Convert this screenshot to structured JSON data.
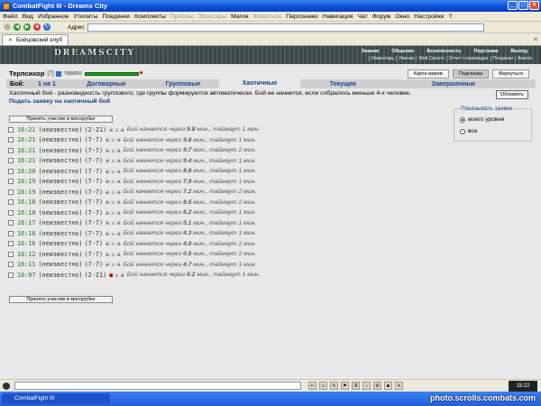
{
  "window": {
    "title": "CombatFight III - Dreams City"
  },
  "menu": [
    {
      "label": "Файл",
      "dim": false
    },
    {
      "label": "Вид",
      "dim": false
    },
    {
      "label": "Избранное",
      "dim": false
    },
    {
      "label": "Утилиты",
      "dim": false
    },
    {
      "label": "Поединки",
      "dim": false
    },
    {
      "label": "Комплекты",
      "dim": false
    },
    {
      "label": "Приёмы",
      "dim": true
    },
    {
      "label": "Эликсиры",
      "dim": true
    },
    {
      "label": "Магия",
      "dim": false
    },
    {
      "label": "Животное",
      "dim": true
    },
    {
      "label": "Персонажи",
      "dim": false
    },
    {
      "label": "Навигация",
      "dim": false
    },
    {
      "label": "Чат",
      "dim": false
    },
    {
      "label": "Форум",
      "dim": false
    },
    {
      "label": "Окно",
      "dim": false
    },
    {
      "label": "Настройки",
      "dim": false
    },
    {
      "label": "?",
      "dim": false
    }
  ],
  "toolbar": {
    "address_label": "Адрес"
  },
  "tab": {
    "label": "Бойцовский клуб"
  },
  "header": {
    "logo": "DREAMSCITY",
    "nav": [
      "Знания",
      "Общение",
      "Безопасность",
      "Персонаж",
      "Выход"
    ],
    "sub": [
      "Инвентарь",
      "Умения",
      "Мой Скролл",
      "Отчет о переводах",
      "Поединки",
      "Анкета"
    ]
  },
  "player": {
    "name": "Терпсихор",
    "level": "[7]",
    "hp": "788/800"
  },
  "top_buttons": [
    "Карта миров",
    "Подсказка",
    "Вернуться"
  ],
  "battle_tabs": {
    "label": "Бой:",
    "items": [
      "1 на 1",
      "Договорные",
      "Групповые",
      "Хаотичные",
      "Текущие",
      "Завершенные"
    ],
    "active_index": 3
  },
  "description": "Хаотичный бой - разновидность группового, где группы формируются автоматически. Бой не начнется, если собралось меньше 4-х человек.",
  "submit_link": "Подать заявку на хаотичный бой",
  "refresh_button": "Обновить",
  "filter": {
    "title": "Показывать заявки",
    "options": [
      "моего уровня",
      "все"
    ],
    "selected": 0
  },
  "join_button": "Принять участие в мясорубке",
  "bids": [
    {
      "time": "16:21",
      "who": "(неизвестно)",
      "range": "(2-21)",
      "drop": false,
      "pre": "Бой начнется через",
      "mins": "9.8",
      "mid": "мин., таймаут",
      "timeout": "1",
      "post": "мин."
    },
    {
      "time": "16:21",
      "who": "(неизвестно)",
      "range": "(7-7)",
      "drop": false,
      "pre": "Бой начнется через",
      "mins": "9.8",
      "mid": "мин., таймаут",
      "timeout": "1",
      "post": "мин."
    },
    {
      "time": "16:21",
      "who": "(неизвестно)",
      "range": "(7-7)",
      "drop": false,
      "pre": "Бой начнется через",
      "mins": "9.7",
      "mid": "мин., таймаут",
      "timeout": "2",
      "post": "мин."
    },
    {
      "time": "16:21",
      "who": "(неизвестно)",
      "range": "(7-7)",
      "drop": false,
      "pre": "Бой начнется через",
      "mins": "9.4",
      "mid": "мин., таймаут",
      "timeout": "1",
      "post": "мин."
    },
    {
      "time": "16:20",
      "who": "(неизвестно)",
      "range": "(7-7)",
      "drop": false,
      "pre": "Бой начнется через",
      "mins": "8.8",
      "mid": "мин., таймаут",
      "timeout": "1",
      "post": "мин."
    },
    {
      "time": "16:19",
      "who": "(неизвестно)",
      "range": "(7-7)",
      "drop": false,
      "pre": "Бой начнется через",
      "mins": "7.9",
      "mid": "мин., таймаут",
      "timeout": "1",
      "post": "мин."
    },
    {
      "time": "16:19",
      "who": "(неизвестно)",
      "range": "(7-7)",
      "drop": false,
      "pre": "Бой начнется через",
      "mins": "7.2",
      "mid": "мин., таймаут",
      "timeout": "2",
      "post": "мин."
    },
    {
      "time": "16:18",
      "who": "(неизвестно)",
      "range": "(7-7)",
      "drop": false,
      "pre": "Бой начнется через",
      "mins": "6.5",
      "mid": "мин., таймаут",
      "timeout": "2",
      "post": "мин."
    },
    {
      "time": "16:18",
      "who": "(неизвестно)",
      "range": "(7-7)",
      "drop": false,
      "pre": "Бой начнется через",
      "mins": "6.2",
      "mid": "мин., таймаут",
      "timeout": "1",
      "post": "мин."
    },
    {
      "time": "16:17",
      "who": "(неизвестно)",
      "range": "(7-7)",
      "drop": false,
      "pre": "Бой начнется через",
      "mins": "5.1",
      "mid": "мин., таймаут",
      "timeout": "1",
      "post": "мин."
    },
    {
      "time": "16:16",
      "who": "(неизвестно)",
      "range": "(7-7)",
      "drop": false,
      "pre": "Бой начнется через",
      "mins": "4.3",
      "mid": "мин., таймаут",
      "timeout": "1",
      "post": "мин."
    },
    {
      "time": "16:16",
      "who": "(неизвестно)",
      "range": "(7-7)",
      "drop": false,
      "pre": "Бой начнется через",
      "mins": "4.0",
      "mid": "мин., таймаут",
      "timeout": "2",
      "post": "мин."
    },
    {
      "time": "16:12",
      "who": "(неизвестно)",
      "range": "(7-7)",
      "drop": false,
      "pre": "Бой начнется через",
      "mins": "0.5",
      "mid": "мин., таймаут",
      "timeout": "2",
      "post": "мин."
    },
    {
      "time": "16:11",
      "who": "(неизвестно)",
      "range": "(7-7)",
      "drop": false,
      "pre": "Бой начнется через",
      "mins": "4.7",
      "mid": "мин., таймаут",
      "timeout": "1",
      "post": "мин."
    },
    {
      "time": "16:07",
      "who": "(неизвестно)",
      "range": "(2-21)",
      "drop": true,
      "pre": "Бой начнется через",
      "mins": "0.2",
      "mid": "мин., таймаут",
      "timeout": "1",
      "post": "мин."
    }
  ],
  "taskbar": {
    "item": "CombatFight III"
  },
  "clock": "15:22",
  "watermark": "photo.scrolls.combats.com"
}
